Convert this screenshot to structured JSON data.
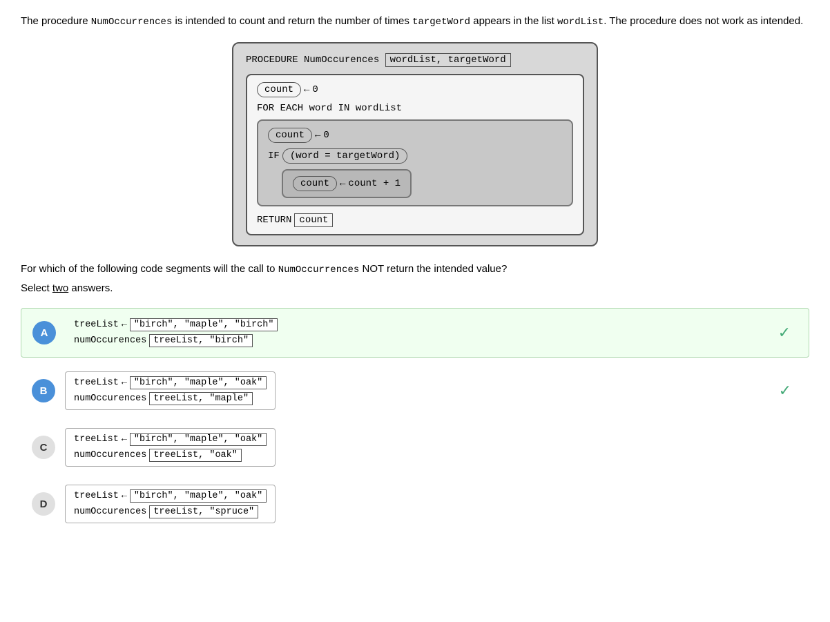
{
  "intro": {
    "text1": "The procedure ",
    "proc_name": "NumOccurrences",
    "text2": " is intended to count and return the number of times ",
    "target_word": "targetWord",
    "text3": " appears in the list ",
    "word_list": "wordList",
    "text4": ". The procedure does not work as intended."
  },
  "procedure": {
    "header": "PROCEDURE NumOccurences",
    "params_wordList": "wordList",
    "params_targetWord": "targetWord",
    "line1_var": "count",
    "line1_arrow": "←",
    "line1_val": "0",
    "for_each": "FOR EACH word IN wordList",
    "inner_line1_var": "count",
    "inner_line1_arrow": "←",
    "inner_line1_val": "0",
    "if_line": "IF",
    "if_word": "word",
    "if_eq": "=",
    "if_target": "targetWord",
    "assign_left": "count",
    "assign_arrow": "←",
    "assign_right": "count + 1",
    "return_label": "RETURN",
    "return_var": "count"
  },
  "question": {
    "text": "For which of the following code segments will the call to ",
    "mono": "NumOccurrences",
    "text2": " NOT return the intended value?"
  },
  "select": {
    "prefix": "Select ",
    "word": "two",
    "suffix": " answers."
  },
  "options": [
    {
      "letter": "A",
      "selected": true,
      "line1_var": "treeList",
      "line1_arrow": "←",
      "line1_box": "\"birch\",  \"maple\",  \"birch\"",
      "line2_proc": "numOccurences",
      "line2_box": "treeList,  \"birch\""
    },
    {
      "letter": "B",
      "selected": true,
      "line1_var": "treeList",
      "line1_arrow": "←",
      "line1_box": "\"birch\",  \"maple\",  \"oak\"",
      "line2_proc": "numOccurences",
      "line2_box": "treeList,  \"maple\""
    },
    {
      "letter": "C",
      "selected": false,
      "line1_var": "treeList",
      "line1_arrow": "←",
      "line1_box": "\"birch\",  \"maple\",  \"oak\"",
      "line2_proc": "numOccurences",
      "line2_box": "treeList,  \"oak\""
    },
    {
      "letter": "D",
      "selected": false,
      "line1_var": "treeList",
      "line1_arrow": "←",
      "line1_box": "\"birch\",  \"maple\",  \"oak\"",
      "line2_proc": "numOccurences",
      "line2_box": "treeList,  \"spruce\""
    }
  ]
}
